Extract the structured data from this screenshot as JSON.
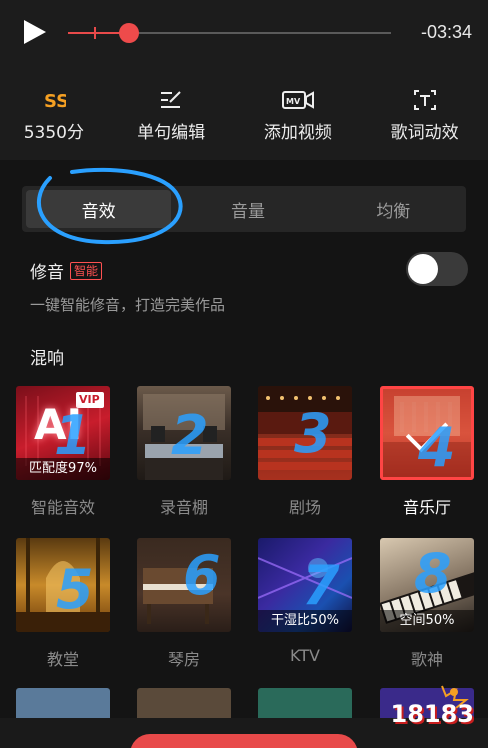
{
  "player": {
    "time": "-03:34",
    "progress": 0.19
  },
  "tools": [
    {
      "icon": "score-icon",
      "label": "5350分"
    },
    {
      "icon": "edit-line-icon",
      "label": "单句编辑"
    },
    {
      "icon": "mv-icon",
      "label": "添加视频"
    },
    {
      "icon": "lyric-effect-icon",
      "label": "歌词动效"
    }
  ],
  "tabs": [
    {
      "label": "音效",
      "active": true
    },
    {
      "label": "音量",
      "active": false
    },
    {
      "label": "均衡",
      "active": false
    }
  ],
  "tuning": {
    "title": "修音",
    "badge": "智能",
    "desc": "一键智能修音，打造完美作品",
    "enabled": false
  },
  "reverb": {
    "title": "混响",
    "items": [
      {
        "name": "智能音效",
        "badge": "匹配度97%",
        "annot": "1",
        "selected": false
      },
      {
        "name": "录音棚",
        "badge": "",
        "annot": "2",
        "selected": false
      },
      {
        "name": "剧场",
        "badge": "",
        "annot": "3",
        "selected": false
      },
      {
        "name": "音乐厅",
        "badge": "",
        "annot": "4",
        "selected": true
      },
      {
        "name": "教堂",
        "badge": "",
        "annot": "5",
        "selected": false
      },
      {
        "name": "琴房",
        "badge": "",
        "annot": "6",
        "selected": false
      },
      {
        "name": "KTV",
        "badge": "干湿比50%",
        "annot": "7",
        "selected": false
      },
      {
        "name": "歌神",
        "badge": "空间50%",
        "annot": "8",
        "selected": false
      }
    ],
    "vip_label": "VIP",
    "ai_label": "AI"
  },
  "watermark": "18183",
  "colors": {
    "accent": "#e84a4a",
    "orange": "#f5a023",
    "annotation": "#2aa0ff"
  }
}
